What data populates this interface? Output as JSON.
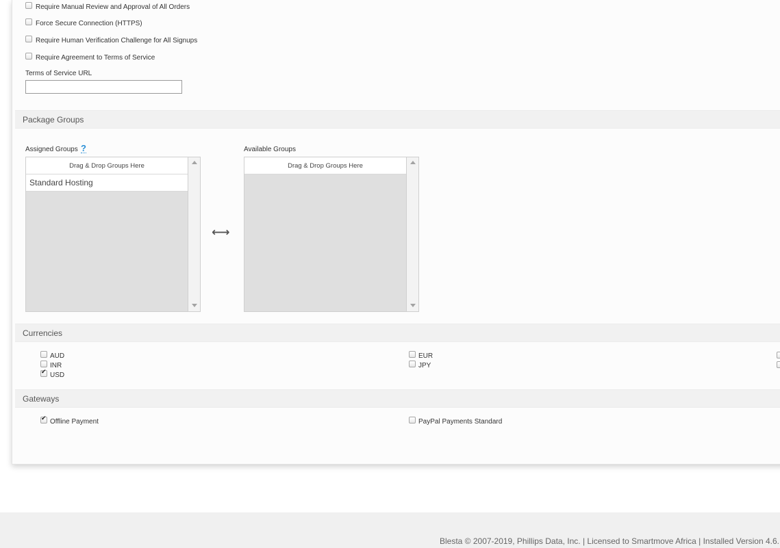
{
  "order_settings": {
    "checkboxes": [
      {
        "label": "Require Manual Review and Approval of All Orders",
        "checked": false
      },
      {
        "label": "Force Secure Connection (HTTPS)",
        "checked": false
      },
      {
        "label": "Require Human Verification Challenge for All Signups",
        "checked": false
      },
      {
        "label": "Require Agreement to Terms of Service",
        "checked": false
      }
    ],
    "tos_label": "Terms of Service URL",
    "tos_value": ""
  },
  "package_groups": {
    "title": "Package Groups",
    "assigned_label": "Assigned Groups",
    "help_icon": "?",
    "available_label": "Available Groups",
    "drop_text": "Drag & Drop Groups Here",
    "assigned_items": [
      "Standard Hosting"
    ],
    "available_items": []
  },
  "currencies": {
    "title": "Currencies",
    "items": [
      {
        "code": "AUD",
        "checked": false
      },
      {
        "code": "EUR",
        "checked": false
      },
      {
        "code": "INR",
        "checked": false
      },
      {
        "code": "JPY",
        "checked": false
      },
      {
        "code": "USD",
        "checked": true
      }
    ]
  },
  "gateways": {
    "title": "Gateways",
    "items": [
      {
        "label": "Offline Payment",
        "checked": true
      },
      {
        "label": "PayPal Payments Standard",
        "checked": false
      }
    ]
  },
  "footer": {
    "text": "Blesta © 2007-2019, Phillips Data, Inc. | Licensed to Smartmove Africa | Installed Version 4.6."
  },
  "icons": {
    "swap": "left-right-arrows-icon",
    "help": "question-mark-icon"
  }
}
